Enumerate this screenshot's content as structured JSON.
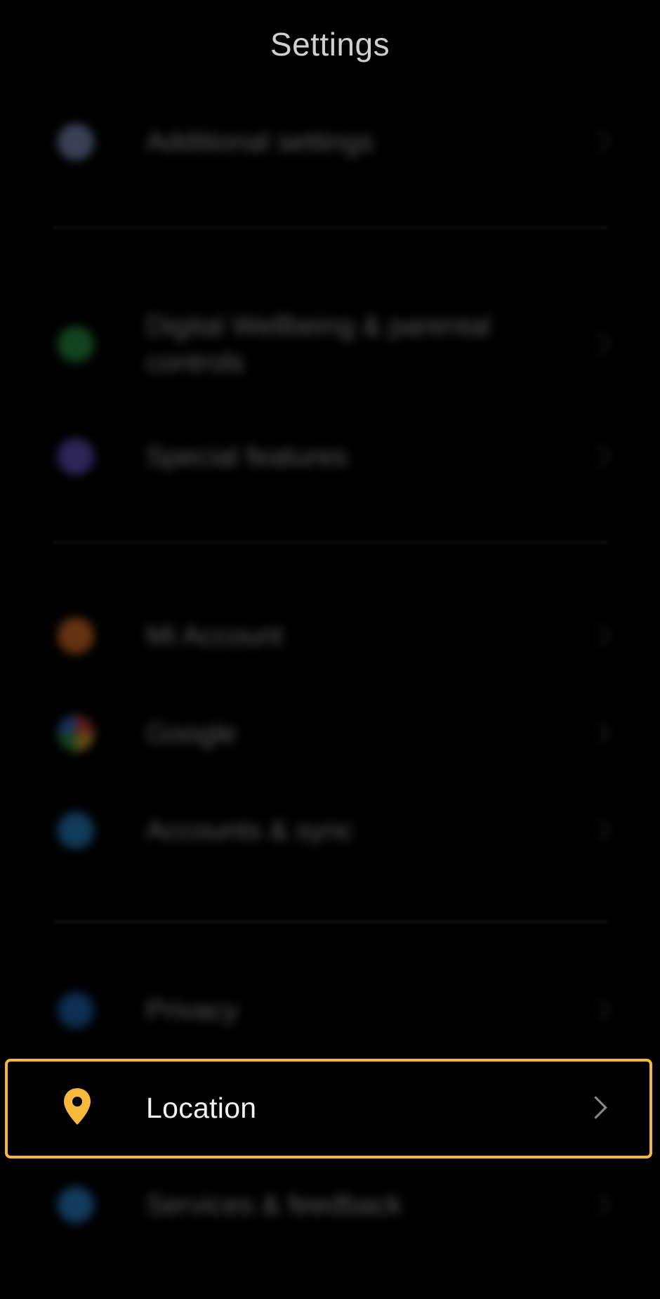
{
  "header": {
    "title": "Settings"
  },
  "rows": [
    {
      "label": "Additional settings",
      "icon": "gear-icon",
      "color": "#8f9bd0"
    },
    {
      "label": "Digital Wellbeing & parental controls",
      "icon": "wellbeing-icon",
      "color": "#2fa34a"
    },
    {
      "label": "Special features",
      "icon": "star-icon",
      "color": "#6e5bd6"
    },
    {
      "label": "Mi Account",
      "icon": "mi-account-icon",
      "color": "#f07a2a"
    },
    {
      "label": "Google",
      "icon": "google-icon",
      "color": "#3c7be0"
    },
    {
      "label": "Accounts & sync",
      "icon": "account-sync-icon",
      "color": "#2a8fd8"
    },
    {
      "label": "Privacy",
      "icon": "privacy-icon",
      "color": "#1f6fc0"
    },
    {
      "label": "Services & feedback",
      "icon": "feedback-icon",
      "color": "#2f8ee0"
    }
  ],
  "location": {
    "label": "Location",
    "icon": "location-pin-icon",
    "color": "#f6b93b"
  }
}
